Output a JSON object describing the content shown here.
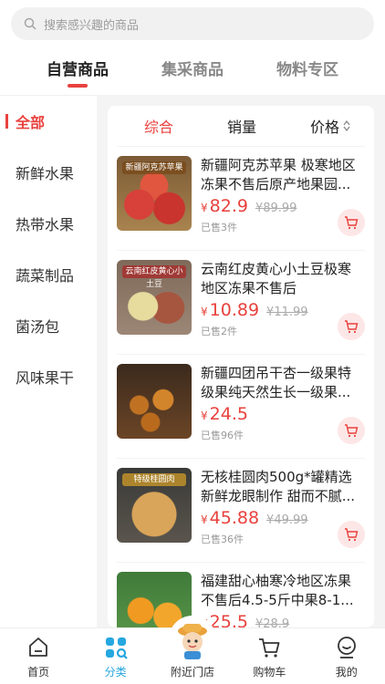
{
  "search": {
    "placeholder": "搜索感兴趣的商品"
  },
  "tabs": [
    {
      "label": "自营商品"
    },
    {
      "label": "集采商品"
    },
    {
      "label": "物料专区"
    }
  ],
  "sidebar": {
    "items": [
      {
        "label": "全部"
      },
      {
        "label": "新鲜水果"
      },
      {
        "label": "热带水果"
      },
      {
        "label": "蔬菜制品"
      },
      {
        "label": "菌汤包"
      },
      {
        "label": "风味果干"
      }
    ]
  },
  "sort": {
    "comprehensive": "综合",
    "sales": "销量",
    "price": "价格"
  },
  "products": [
    {
      "title": "新疆阿克苏苹果 极寒地区冻果不售后原产地果园...",
      "currency": "¥",
      "price": "82.9",
      "orig": "¥89.99",
      "sold": "已售3件",
      "thumb_label": "新疆阿克苏苹果"
    },
    {
      "title": "云南红皮黄心小土豆极寒地区冻果不售后",
      "currency": "¥",
      "price": "10.89",
      "orig": "¥11.99",
      "sold": "已售2件",
      "thumb_label": "云南红皮黄心小土豆"
    },
    {
      "title": "新疆四团吊干杏一级果特级果纯天然生长一级果...",
      "currency": "¥",
      "price": "24.5",
      "orig": "",
      "sold": "已售96件",
      "thumb_label": ""
    },
    {
      "title": "无核桂圆肉500g*罐精选新鲜龙眼制作 甜而不腻...",
      "currency": "¥",
      "price": "45.88",
      "orig": "¥49.99",
      "sold": "已售36件",
      "thumb_label": "特级桂圆肉"
    },
    {
      "title": "福建甜心柚寒冷地区冻果不售后4.5-5斤中果8-1...",
      "currency": "¥",
      "price": "25.5",
      "orig": "¥28.9",
      "sold": "",
      "thumb_label": ""
    }
  ],
  "nav": [
    {
      "label": "首页"
    },
    {
      "label": "分类"
    },
    {
      "label": "附近门店"
    },
    {
      "label": "购物车"
    },
    {
      "label": "我的"
    }
  ],
  "colors": {
    "accent": "#e8413d",
    "nav_active": "#25a7e0"
  }
}
